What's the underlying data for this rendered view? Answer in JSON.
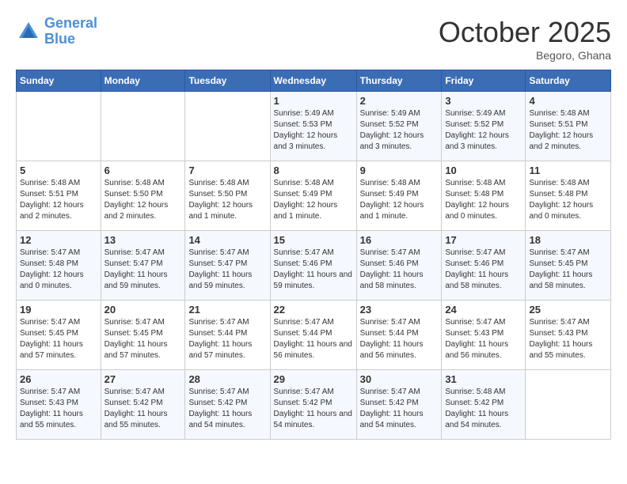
{
  "logo": {
    "line1": "General",
    "line2": "Blue"
  },
  "title": "October 2025",
  "location": "Begoro, Ghana",
  "weekdays": [
    "Sunday",
    "Monday",
    "Tuesday",
    "Wednesday",
    "Thursday",
    "Friday",
    "Saturday"
  ],
  "weeks": [
    [
      {
        "day": "",
        "sunrise": "",
        "sunset": "",
        "daylight": ""
      },
      {
        "day": "",
        "sunrise": "",
        "sunset": "",
        "daylight": ""
      },
      {
        "day": "",
        "sunrise": "",
        "sunset": "",
        "daylight": ""
      },
      {
        "day": "1",
        "sunrise": "Sunrise: 5:49 AM",
        "sunset": "Sunset: 5:53 PM",
        "daylight": "Daylight: 12 hours and 3 minutes."
      },
      {
        "day": "2",
        "sunrise": "Sunrise: 5:49 AM",
        "sunset": "Sunset: 5:52 PM",
        "daylight": "Daylight: 12 hours and 3 minutes."
      },
      {
        "day": "3",
        "sunrise": "Sunrise: 5:49 AM",
        "sunset": "Sunset: 5:52 PM",
        "daylight": "Daylight: 12 hours and 3 minutes."
      },
      {
        "day": "4",
        "sunrise": "Sunrise: 5:48 AM",
        "sunset": "Sunset: 5:51 PM",
        "daylight": "Daylight: 12 hours and 2 minutes."
      }
    ],
    [
      {
        "day": "5",
        "sunrise": "Sunrise: 5:48 AM",
        "sunset": "Sunset: 5:51 PM",
        "daylight": "Daylight: 12 hours and 2 minutes."
      },
      {
        "day": "6",
        "sunrise": "Sunrise: 5:48 AM",
        "sunset": "Sunset: 5:50 PM",
        "daylight": "Daylight: 12 hours and 2 minutes."
      },
      {
        "day": "7",
        "sunrise": "Sunrise: 5:48 AM",
        "sunset": "Sunset: 5:50 PM",
        "daylight": "Daylight: 12 hours and 1 minute."
      },
      {
        "day": "8",
        "sunrise": "Sunrise: 5:48 AM",
        "sunset": "Sunset: 5:49 PM",
        "daylight": "Daylight: 12 hours and 1 minute."
      },
      {
        "day": "9",
        "sunrise": "Sunrise: 5:48 AM",
        "sunset": "Sunset: 5:49 PM",
        "daylight": "Daylight: 12 hours and 1 minute."
      },
      {
        "day": "10",
        "sunrise": "Sunrise: 5:48 AM",
        "sunset": "Sunset: 5:48 PM",
        "daylight": "Daylight: 12 hours and 0 minutes."
      },
      {
        "day": "11",
        "sunrise": "Sunrise: 5:48 AM",
        "sunset": "Sunset: 5:48 PM",
        "daylight": "Daylight: 12 hours and 0 minutes."
      }
    ],
    [
      {
        "day": "12",
        "sunrise": "Sunrise: 5:47 AM",
        "sunset": "Sunset: 5:48 PM",
        "daylight": "Daylight: 12 hours and 0 minutes."
      },
      {
        "day": "13",
        "sunrise": "Sunrise: 5:47 AM",
        "sunset": "Sunset: 5:47 PM",
        "daylight": "Daylight: 11 hours and 59 minutes."
      },
      {
        "day": "14",
        "sunrise": "Sunrise: 5:47 AM",
        "sunset": "Sunset: 5:47 PM",
        "daylight": "Daylight: 11 hours and 59 minutes."
      },
      {
        "day": "15",
        "sunrise": "Sunrise: 5:47 AM",
        "sunset": "Sunset: 5:46 PM",
        "daylight": "Daylight: 11 hours and 59 minutes."
      },
      {
        "day": "16",
        "sunrise": "Sunrise: 5:47 AM",
        "sunset": "Sunset: 5:46 PM",
        "daylight": "Daylight: 11 hours and 58 minutes."
      },
      {
        "day": "17",
        "sunrise": "Sunrise: 5:47 AM",
        "sunset": "Sunset: 5:46 PM",
        "daylight": "Daylight: 11 hours and 58 minutes."
      },
      {
        "day": "18",
        "sunrise": "Sunrise: 5:47 AM",
        "sunset": "Sunset: 5:45 PM",
        "daylight": "Daylight: 11 hours and 58 minutes."
      }
    ],
    [
      {
        "day": "19",
        "sunrise": "Sunrise: 5:47 AM",
        "sunset": "Sunset: 5:45 PM",
        "daylight": "Daylight: 11 hours and 57 minutes."
      },
      {
        "day": "20",
        "sunrise": "Sunrise: 5:47 AM",
        "sunset": "Sunset: 5:45 PM",
        "daylight": "Daylight: 11 hours and 57 minutes."
      },
      {
        "day": "21",
        "sunrise": "Sunrise: 5:47 AM",
        "sunset": "Sunset: 5:44 PM",
        "daylight": "Daylight: 11 hours and 57 minutes."
      },
      {
        "day": "22",
        "sunrise": "Sunrise: 5:47 AM",
        "sunset": "Sunset: 5:44 PM",
        "daylight": "Daylight: 11 hours and 56 minutes."
      },
      {
        "day": "23",
        "sunrise": "Sunrise: 5:47 AM",
        "sunset": "Sunset: 5:44 PM",
        "daylight": "Daylight: 11 hours and 56 minutes."
      },
      {
        "day": "24",
        "sunrise": "Sunrise: 5:47 AM",
        "sunset": "Sunset: 5:43 PM",
        "daylight": "Daylight: 11 hours and 56 minutes."
      },
      {
        "day": "25",
        "sunrise": "Sunrise: 5:47 AM",
        "sunset": "Sunset: 5:43 PM",
        "daylight": "Daylight: 11 hours and 55 minutes."
      }
    ],
    [
      {
        "day": "26",
        "sunrise": "Sunrise: 5:47 AM",
        "sunset": "Sunset: 5:43 PM",
        "daylight": "Daylight: 11 hours and 55 minutes."
      },
      {
        "day": "27",
        "sunrise": "Sunrise: 5:47 AM",
        "sunset": "Sunset: 5:42 PM",
        "daylight": "Daylight: 11 hours and 55 minutes."
      },
      {
        "day": "28",
        "sunrise": "Sunrise: 5:47 AM",
        "sunset": "Sunset: 5:42 PM",
        "daylight": "Daylight: 11 hours and 54 minutes."
      },
      {
        "day": "29",
        "sunrise": "Sunrise: 5:47 AM",
        "sunset": "Sunset: 5:42 PM",
        "daylight": "Daylight: 11 hours and 54 minutes."
      },
      {
        "day": "30",
        "sunrise": "Sunrise: 5:47 AM",
        "sunset": "Sunset: 5:42 PM",
        "daylight": "Daylight: 11 hours and 54 minutes."
      },
      {
        "day": "31",
        "sunrise": "Sunrise: 5:48 AM",
        "sunset": "Sunset: 5:42 PM",
        "daylight": "Daylight: 11 hours and 54 minutes."
      },
      {
        "day": "",
        "sunrise": "",
        "sunset": "",
        "daylight": ""
      }
    ]
  ]
}
